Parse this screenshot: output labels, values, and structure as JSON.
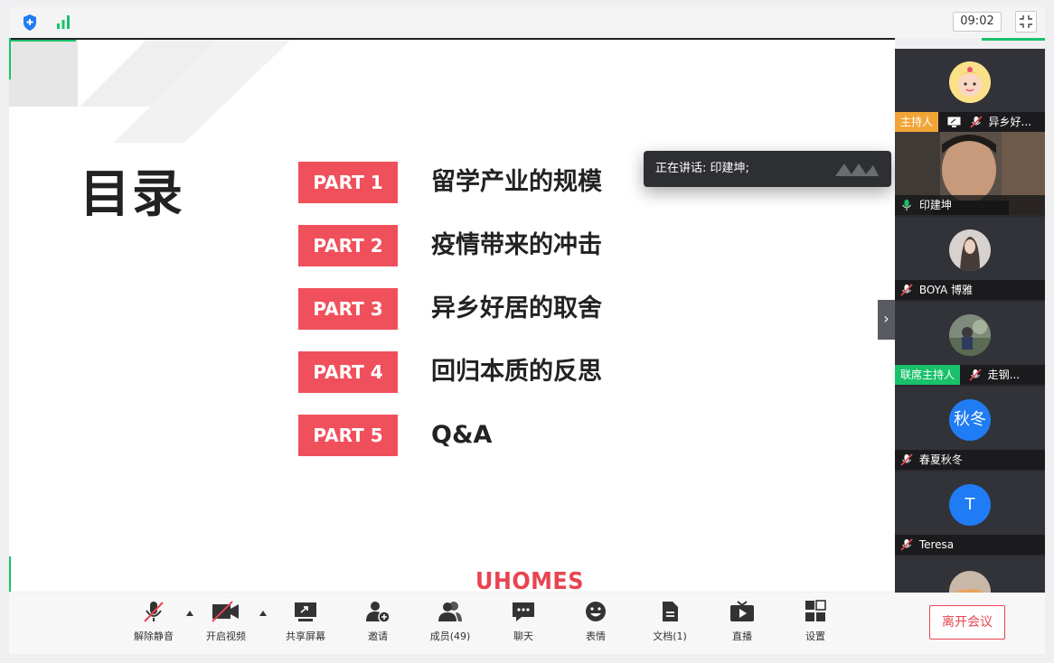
{
  "topbar": {
    "time": "09:02"
  },
  "slide": {
    "title": "目录",
    "parts": [
      {
        "label": "PART 1",
        "text": "留学产业的规模"
      },
      {
        "label": "PART 2",
        "text": "疫情带来的冲击"
      },
      {
        "label": "PART 3",
        "text": "异乡好居的取舍"
      },
      {
        "label": "PART 4",
        "text": "回归本质的反思"
      },
      {
        "label": "PART 5",
        "text": "Q&A"
      }
    ],
    "logo": "UHOMES"
  },
  "speaking": {
    "text": "正在讲话: 印建坤;"
  },
  "participants": [
    {
      "tag": "主持人",
      "name": "异乡好...",
      "avatar": "cartoon-avatar"
    },
    {
      "name": "印建坤",
      "avatar": "video"
    },
    {
      "name": "BOYA 博雅",
      "avatar": "photo-avatar"
    },
    {
      "tag": "联席主持人",
      "name": "走钢...",
      "avatar": "photo-avatar"
    },
    {
      "name": "春夏秋冬",
      "avatar_text": "秋冬"
    },
    {
      "name": "Teresa",
      "avatar_text": "T"
    }
  ],
  "toolbar": {
    "unmute": "解除静音",
    "start_video": "开启视频",
    "share_screen": "共享屏幕",
    "invite": "邀请",
    "members": "成员(49)",
    "chat": "聊天",
    "reactions": "表情",
    "docs": "文档(1)",
    "live": "直播",
    "settings": "设置",
    "leave": "离开会议"
  },
  "colors": {
    "accent_green": "#19c16a",
    "part_red": "#f0505c",
    "host_orange": "#f2a537",
    "avatar_blue": "#1f7cf5",
    "leave_red": "#e84451"
  }
}
